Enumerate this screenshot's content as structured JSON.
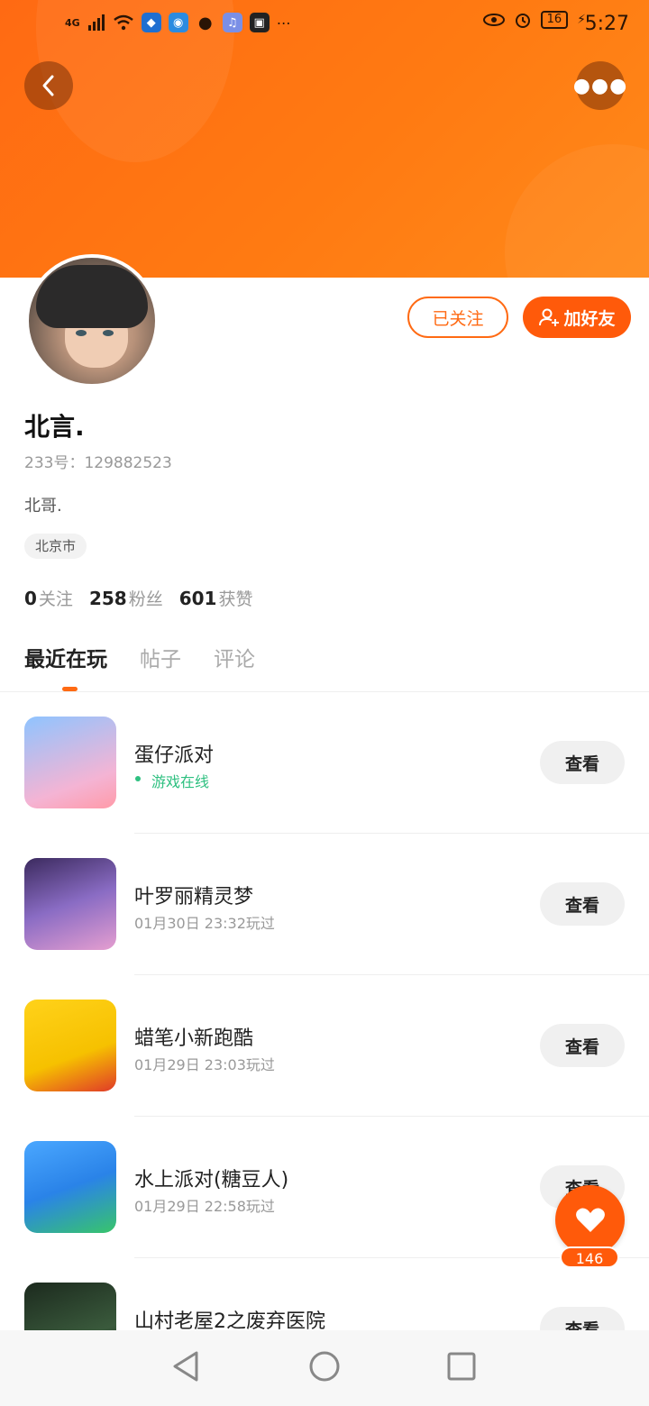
{
  "status_bar": {
    "network": "4G",
    "battery": "16",
    "time": "5:27"
  },
  "profile": {
    "name": "北言.",
    "uid_label": "233号：",
    "uid": "129882523",
    "bio": "北哥.",
    "location": "北京市",
    "followed_label": "已关注",
    "add_friend_label": "加好友"
  },
  "stats": {
    "following": "0",
    "following_label": "关注",
    "fans": "258",
    "fans_label": "粉丝",
    "likes": "601",
    "likes_label": "获赞"
  },
  "tabs": [
    {
      "label": "最近在玩",
      "active": true
    },
    {
      "label": "帖子"
    },
    {
      "label": "评论"
    }
  ],
  "games": [
    {
      "title": "蛋仔派对",
      "subtitle": "游戏在线",
      "online": true,
      "button": "查看"
    },
    {
      "title": "叶罗丽精灵梦",
      "subtitle": "01月30日 23:32玩过",
      "button": "查看"
    },
    {
      "title": "蜡笔小新跑酷",
      "subtitle": "01月29日 23:03玩过",
      "button": "查看"
    },
    {
      "title": "水上派对(糖豆人)",
      "subtitle": "01月29日 22:58玩过",
      "button": "查看"
    },
    {
      "title": "山村老屋2之废弃医院",
      "subtitle": "",
      "button": "查看"
    }
  ],
  "like_fab": {
    "count": "146"
  },
  "colors": {
    "accent": "#ff6a13",
    "online": "#2ec080"
  }
}
